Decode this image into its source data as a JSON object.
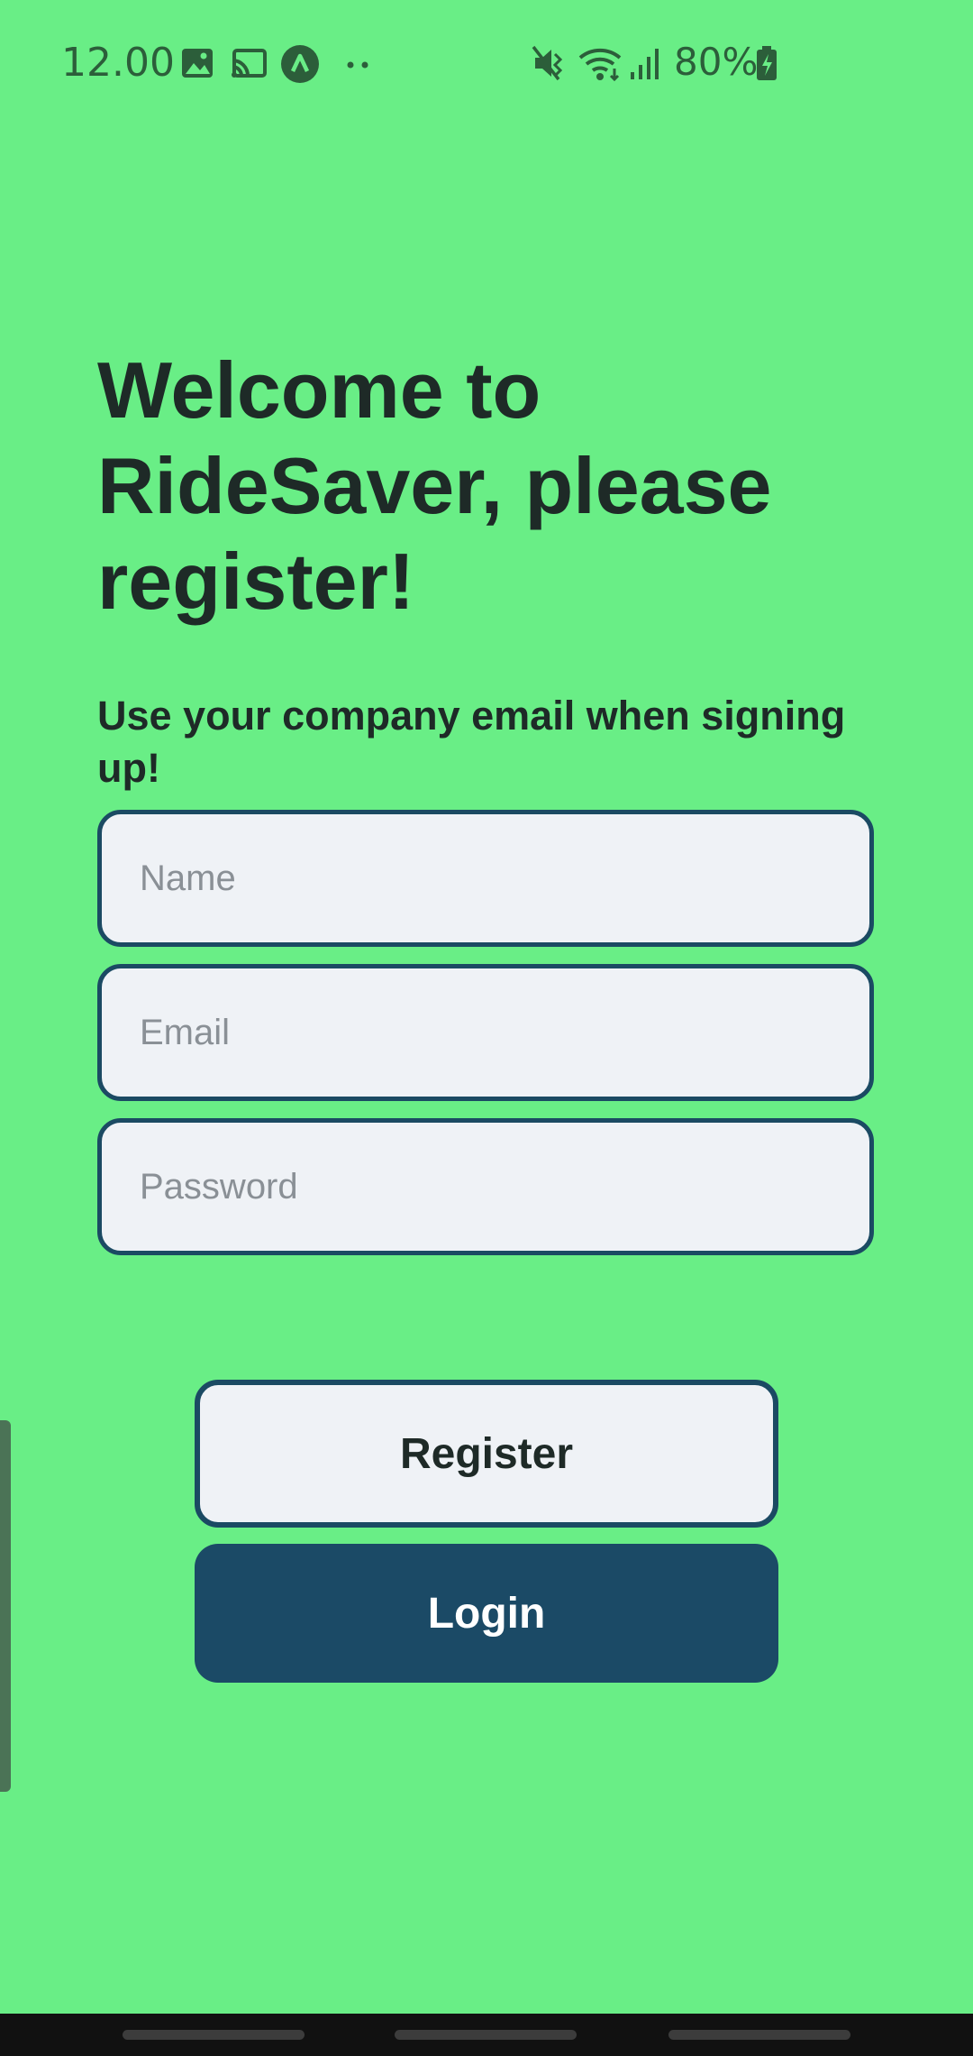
{
  "status_bar": {
    "time": "12.00",
    "battery": "80%",
    "icons": [
      "image-icon",
      "cast-icon",
      "app-notification-icon",
      "more-dots-icon",
      "mute-icon",
      "wifi-icon",
      "signal-icon",
      "battery-charging-icon"
    ]
  },
  "header": {
    "title": "Welcome to RideSaver, please register!",
    "subtitle": "Use your company email when signing up!"
  },
  "form": {
    "name_placeholder": "Name",
    "email_placeholder": "Email",
    "password_placeholder": "Password",
    "name_value": "",
    "email_value": "",
    "password_value": ""
  },
  "actions": {
    "register_label": "Register",
    "login_label": "Login"
  },
  "colors": {
    "background": "#69ee86",
    "primary": "#1b4a66",
    "field_bg": "#eff2f6",
    "text_dark": "#1e2a27"
  }
}
